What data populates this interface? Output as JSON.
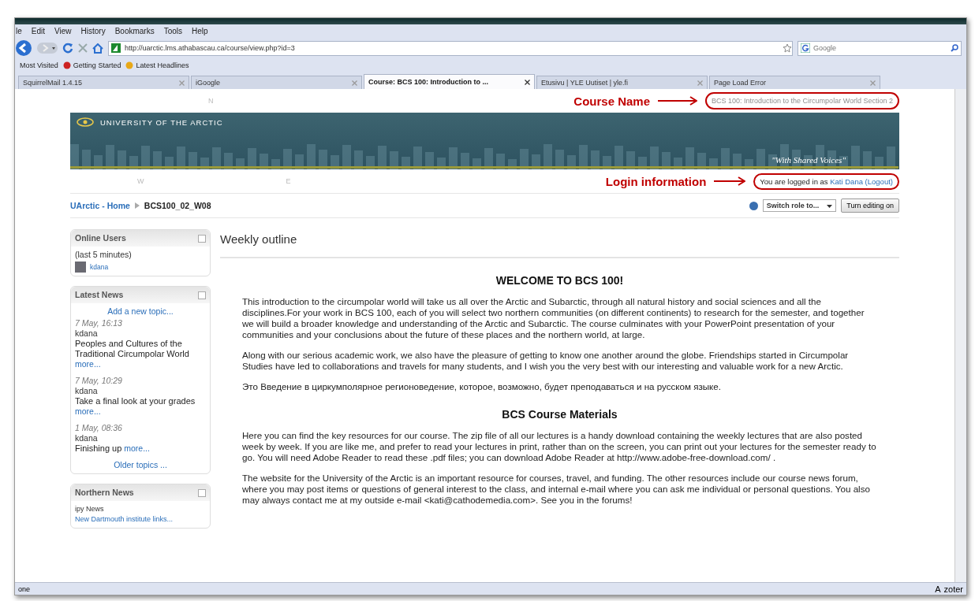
{
  "browser": {
    "menu": [
      "le",
      "Edit",
      "View",
      "History",
      "Bookmarks",
      "Tools",
      "Help"
    ],
    "url": "http://uarctic.lms.athabascau.ca/course/view.php?id=3",
    "search_placeholder": "Google",
    "bookmarks": [
      "Most Visited",
      "Getting Started",
      "Latest Headlines"
    ],
    "tabs": [
      {
        "label": "SquirrelMail 1.4.15",
        "selected": false
      },
      {
        "label": "iGoogle",
        "selected": false
      },
      {
        "label": "Course: BCS 100: Introduction to ...",
        "selected": true
      },
      {
        "label": "Etusivu | YLE Uutiset | yle.fi",
        "selected": false
      },
      {
        "label": "Page Load Error",
        "selected": false
      }
    ]
  },
  "page": {
    "compass": [
      "N",
      "W",
      "E"
    ],
    "course_name": "BCS 100: Introduction to the Circumpolar World Section 2",
    "course_annotation": "Course Name",
    "banner": {
      "title": "UNIVERSITY OF THE ARCTIC",
      "motto": "\"With Shared Voices\""
    },
    "login": {
      "prefix": "You are logged in as",
      "user": "Kati Dana",
      "logout": "(Logout)"
    },
    "login_annotation": "Login information",
    "breadcrumb": [
      "UArctic - Home",
      "BCS100_02_W08"
    ],
    "switch_role": "Switch role to...",
    "editing_button": "Turn editing on",
    "blocks": {
      "online_users": {
        "title": "Online Users",
        "note": "(last 5 minutes)",
        "users": [
          "kdana"
        ]
      },
      "latest_news": {
        "title": "Latest News",
        "add": "Add a new topic...",
        "older": "Older topics ...",
        "items": [
          {
            "kind": "block",
            "date": "7 May, 16:13",
            "author": "kdana",
            "title": "Peoples and Cultures of the Traditional Circumpolar World",
            "more": "more..."
          },
          {
            "kind": "block",
            "date": "7 May, 10:29",
            "author": "kdana",
            "title": "Take a final look at your grades",
            "more": "more..."
          },
          {
            "kind": "inline",
            "date": "1 May, 08:36",
            "author": "kdana",
            "title": "Finishing up",
            "more": "more..."
          }
        ]
      },
      "northern_news": {
        "title": "Northern News",
        "items": [
          "ipy News",
          "New Dartmouth institute links..."
        ]
      }
    },
    "main": {
      "title": "Weekly outline",
      "sections": [
        {
          "heading": "WELCOME TO BCS 100!",
          "paragraphs": [
            "This introduction to the circumpolar world will take us all over the Arctic and Subarctic, through all natural history and social sciences and all the disciplines.For your work in BCS 100, each of you will select two northern communities (on different continents) to research for the semester, and together we will build a broader knowledge and understanding of the Arctic and Subarctic. The course culminates with your PowerPoint presentation of your communities and your conclusions about the future of these places and the northern world, at large.",
            "Along with our serious academic work, we also have the pleasure of getting to know one another around the globe. Friendships started in Circumpolar Studies have led to collaborations and travels for many students, and I wish you the very best with our interesting and valuable work for a new Arctic.",
            "Это Введение в циркумполярное регионоведение, которое, возможно, будет преподаваться и на русском языке."
          ]
        },
        {
          "heading": "BCS Course Materials",
          "paragraphs": [
            "Here you can find the key resources for our course. The zip file of all our lectures is a handy download containing the weekly lectures that are also posted week by week. If you are like me, and prefer to read your lectures in print, rather than on the screen, you can print out your lectures for the semester ready to go. You will need Adobe Reader to read these .pdf files; you can download Adobe Reader at http://www.adobe-free-download.com/ .",
            "The website for the University of the Arctic is an important resource for courses, travel, and funding. The other resources include our course news forum, where you may post items or questions of general interest to the class, and internal e-mail where you can ask me individual or personal questions. You also may always contact me at my outside e-mail <kati@cathodemedia.com>. See you in the forums!"
          ]
        }
      ]
    }
  },
  "status_bar": {
    "left": "one",
    "right": [
      "A",
      "zoter"
    ]
  }
}
